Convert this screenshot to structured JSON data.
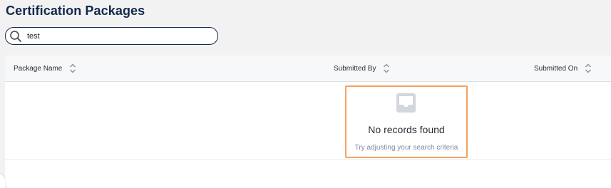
{
  "page": {
    "title": "Certification Packages"
  },
  "search": {
    "value": "test",
    "icon": "search-icon"
  },
  "table": {
    "columns": [
      {
        "label": "Package Name",
        "sort_icon": "sort-icon"
      },
      {
        "label": "Submitted By",
        "sort_icon": "sort-icon"
      },
      {
        "label": "Submitted On",
        "sort_icon": "sort-icon"
      }
    ],
    "rows": []
  },
  "empty_state": {
    "icon": "inbox-icon",
    "title": "No records found",
    "subtitle": "Try adjusting your search criteria"
  },
  "colors": {
    "title": "#13294b",
    "highlight_border": "#f4a261",
    "subtitle": "#7e8aa8"
  }
}
